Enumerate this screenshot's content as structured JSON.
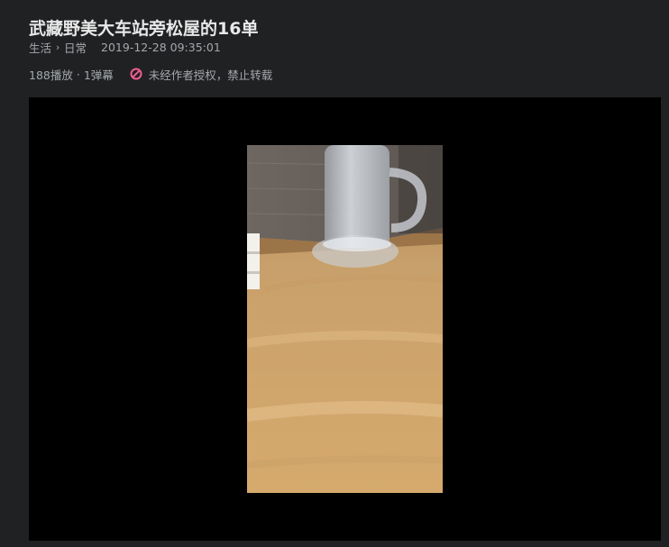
{
  "video": {
    "title": "武藏野美大车站旁松屋的16单"
  },
  "breadcrumb": {
    "category": "生活",
    "subcategory": "日常",
    "separator_icon": "chevron-right-icon"
  },
  "publish_time": "2019-12-28 09:35:01",
  "stats": {
    "plays": "188播放",
    "separator": "·",
    "danmaku": "1弹幕"
  },
  "notice": {
    "icon": "ban-icon",
    "icon_color": "#f25d8e",
    "text": "未经作者授权，禁止转载"
  },
  "colors": {
    "page_background": "#1f2123",
    "player_background": "#000000"
  }
}
